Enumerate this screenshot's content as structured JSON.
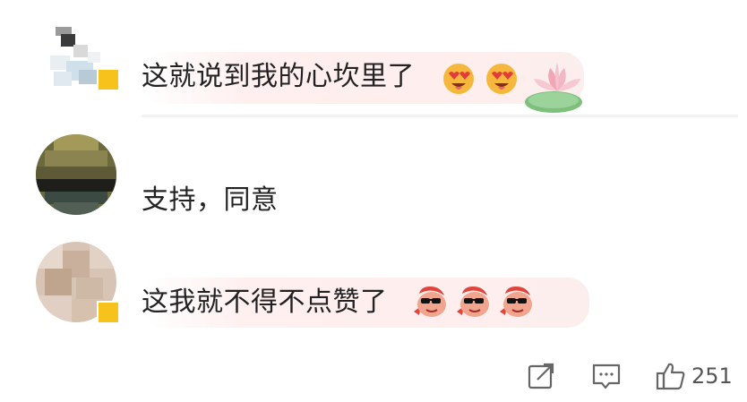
{
  "comments": [
    {
      "text": "这就说到我的心坎里了",
      "emoji": [
        "heart-eyes-face-icon",
        "heart-eyes-face-icon"
      ],
      "sticker": "lotus-icon"
    },
    {
      "text": "支持，同意"
    },
    {
      "text": "这我就不得不点赞了",
      "emoji": [
        "cool-fish-icon",
        "cool-fish-icon",
        "cool-fish-icon"
      ]
    }
  ],
  "actions": {
    "like_count": "251"
  },
  "colors": {
    "bubble": "#fdeeee",
    "badge": "#f7c21b",
    "icon": "#666666"
  }
}
